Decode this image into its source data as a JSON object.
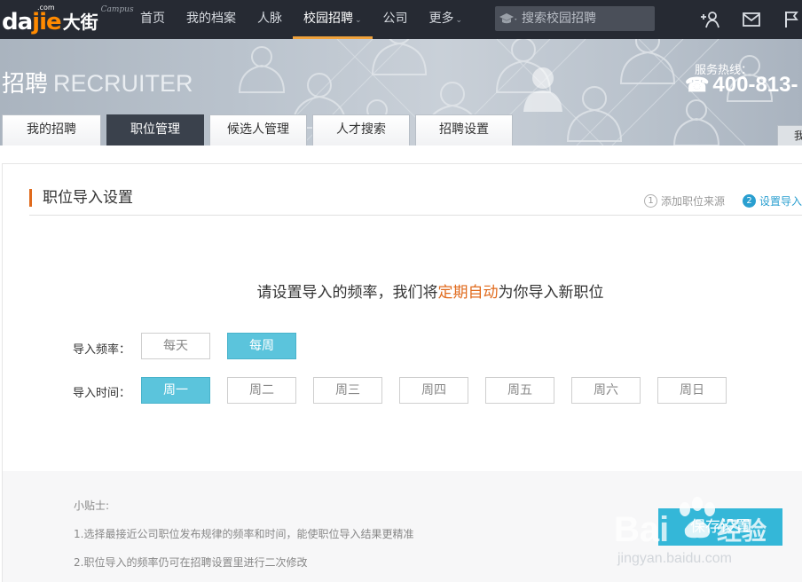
{
  "logo": {
    "main_a": "da",
    "main_b": "jie",
    "com": ".com",
    "cn": "大街",
    "campus": "Campus"
  },
  "nav": {
    "items": [
      {
        "label": "首页",
        "active": false,
        "caret": false
      },
      {
        "label": "我的档案",
        "active": false,
        "caret": false
      },
      {
        "label": "人脉",
        "active": false,
        "caret": false
      },
      {
        "label": "校园招聘",
        "active": true,
        "caret": true
      },
      {
        "label": "公司",
        "active": false,
        "caret": false
      },
      {
        "label": "更多",
        "active": false,
        "caret": true
      }
    ],
    "search_placeholder": "搜索校园招聘"
  },
  "banner": {
    "title_cn": "招聘",
    "title_en": "RECRUITER",
    "hotline_label": "服务热线：",
    "hotline_number": "400-813-"
  },
  "tabs": [
    {
      "label": "我的招聘",
      "active": false
    },
    {
      "label": "职位管理",
      "active": true
    },
    {
      "label": "候选人管理",
      "active": false
    },
    {
      "label": "人才搜索",
      "active": false
    },
    {
      "label": "招聘设置",
      "active": false
    }
  ],
  "tab_right_label": "我",
  "section": {
    "title": "职位导入设置",
    "steps": [
      {
        "num": "1",
        "label": "添加职位来源",
        "active": false
      },
      {
        "num": "2",
        "label": "设置导入",
        "active": true
      }
    ]
  },
  "prompt": {
    "before": "请设置导入的频率，我们将",
    "highlight": "定期自动",
    "after": "为你导入新职位"
  },
  "frequency": {
    "label": "导入频率：",
    "options": [
      {
        "label": "每天",
        "selected": false
      },
      {
        "label": "每周",
        "selected": true
      }
    ]
  },
  "time": {
    "label": "导入时间：",
    "options": [
      {
        "label": "周一",
        "selected": true
      },
      {
        "label": "周二",
        "selected": false
      },
      {
        "label": "周三",
        "selected": false
      },
      {
        "label": "周四",
        "selected": false
      },
      {
        "label": "周五",
        "selected": false
      },
      {
        "label": "周六",
        "selected": false
      },
      {
        "label": "周日",
        "selected": false
      }
    ]
  },
  "tips": {
    "title": "小贴士:",
    "lines": [
      "1.选择最接近公司职位发布规律的频率和时间，能使职位导入结果更精准",
      "2.职位导入的频率仍可在招聘设置里进行二次修改"
    ]
  },
  "save_label": "保存设置",
  "watermark": {
    "brand_a": "Bai",
    "brand_b": "经验",
    "url": "jingyan.baidu.com"
  },
  "colors": {
    "nav_bg": "#262a33",
    "accent_orange": "#e06a1c",
    "selected_blue": "#5bc4dc",
    "button_blue": "#34b7d8",
    "step_blue": "#2a9fd0"
  }
}
